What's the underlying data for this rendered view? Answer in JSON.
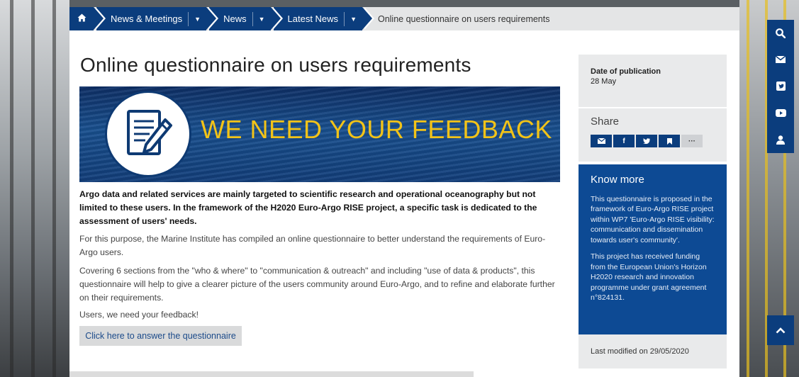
{
  "breadcrumb": {
    "home_icon": "home-icon",
    "items": [
      {
        "label": "News & Meetings"
      },
      {
        "label": "News"
      },
      {
        "label": "Latest News"
      }
    ],
    "current": "Online questionnaire on users requirements"
  },
  "page": {
    "title": "Online questionnaire on users requirements",
    "banner_text": "WE NEED YOUR FEEDBACK",
    "lead": "Argo data and related services are mainly targeted to scientific research and operational oceanography but not limited to these users. In the framework of the H2020 Euro-Argo RISE project, a specific task is dedicated to the assessment of users' needs.",
    "p1": "For this purpose, the Marine Institute has compiled an online questionnaire to better understand the requirements of Euro-Argo users.",
    "p2": "Covering 6 sections from the \"who & where\" to \"communication & outreach\" and including \"use of data & products\", this questionnaire will help to give a clearer picture of the users community around Euro-Argo, and to refine and elaborate further on their requirements.",
    "p3": "Users, we need your feedback!",
    "cta_label": "Click here to answer the questionnaire"
  },
  "sidebar": {
    "pub_label": "Date of publication",
    "pub_date": "28 May",
    "share_title": "Share",
    "share_buttons": [
      "email-icon",
      "facebook-icon",
      "twitter-icon",
      "bookmark-icon",
      "more-icon"
    ],
    "know_title": "Know more",
    "know_p1": "This questionnaire is proposed in the framework of Euro-Argo RISE project within WP7 'Euro-Argo RISE visibility: communication and dissemination towards user's community'.",
    "know_p2": "This project has received funding from the European Union's Horizon H2020 research and innovation programme under grant agreement n°824131.",
    "last_modified": "Last modified on 29/05/2020"
  },
  "social_bar": [
    "search-icon",
    "mail-icon",
    "twitter-icon",
    "youtube-icon",
    "user-icon"
  ],
  "colors": {
    "navy": "#0b3d7d",
    "know_more_bg": "#0d4a94",
    "banner_text": "#f2c318",
    "sidebar_grey": "#e9eaeb"
  }
}
